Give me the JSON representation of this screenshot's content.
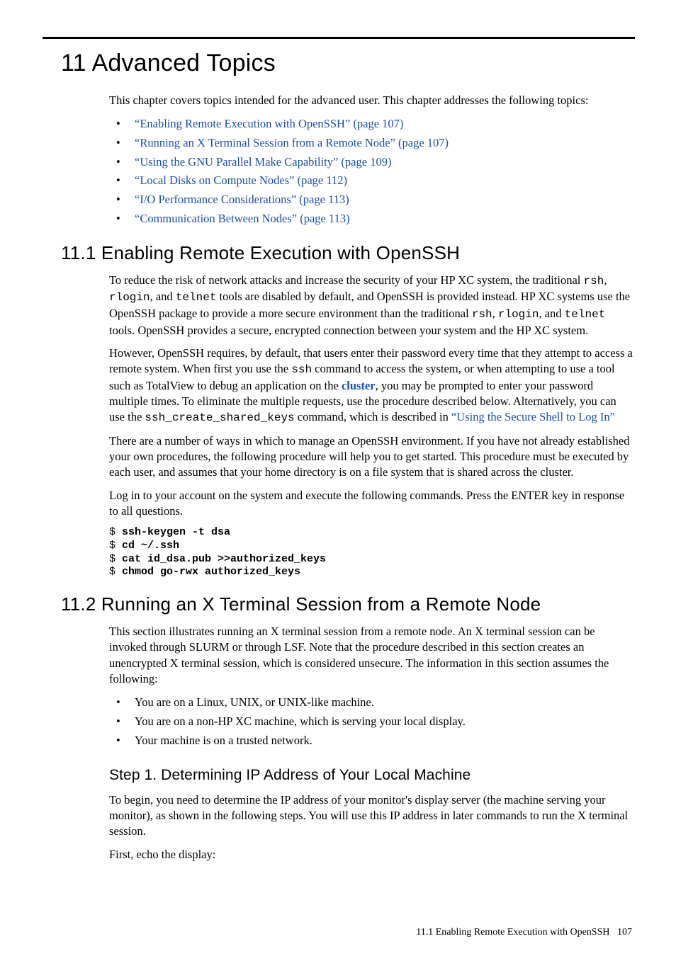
{
  "chapter": {
    "title": "11 Advanced Topics"
  },
  "intro": "This chapter covers topics intended for the advanced user. This chapter addresses the following topics:",
  "toc": [
    "“Enabling Remote Execution with OpenSSH” (page 107)",
    "“Running an X Terminal Session from a Remote Node” (page 107)",
    "“Using the GNU Parallel Make Capability” (page 109)",
    "“Local Disks on Compute Nodes” (page 112)",
    "“I/O Performance Considerations” (page 113)",
    "“Communication Between Nodes” (page 113)"
  ],
  "s11_1": {
    "heading": "11.1 Enabling Remote Execution with OpenSSH",
    "p1a": "To reduce the risk of network attacks and increase the security of your HP XC system, the traditional ",
    "p1b": "rsh",
    "p1c": ", ",
    "p1d": "rlogin",
    "p1e": ", and ",
    "p1f": "telnet",
    "p1g": " tools are disabled by default, and OpenSSH is provided instead. HP XC systems use the OpenSSH package to provide a more secure environment than the traditional ",
    "p1h": "rsh",
    "p1i": ", ",
    "p1j": "rlogin",
    "p1k": ", and ",
    "p1l": "telnet",
    "p1m": " tools. OpenSSH provides a secure, encrypted connection between your system and the HP XC system.",
    "p2a": "However, OpenSSH requires, by default, that users enter their password every time that they attempt to access a remote system. When first you use the ",
    "p2b": "ssh",
    "p2c": " command to access the system, or when attempting to use a tool such as TotalView to debug an application on the ",
    "p2_cluster": "cluster",
    "p2d": ", you may be prompted to enter your password multiple times. To eliminate the multiple requests, use the procedure described below. Alternatively, you can use the ",
    "p2e": "ssh_create_shared_keys",
    "p2f": " command, which is described in ",
    "p2_link": "“Using the Secure Shell to Log In”",
    "p3": "There are a number of ways in which to manage an OpenSSH environment. If you have not already established your own procedures, the following procedure will help you to get started. This procedure must be executed by each user, and assumes that your home directory is on a file system that is shared across the cluster.",
    "p4": "Log in to your account on the system and execute the following commands. Press the ENTER key in response to all questions.",
    "code": {
      "l1p": "$ ",
      "l1b": "ssh-keygen -t dsa",
      "l2p": "$ ",
      "l2b": "cd ~/.ssh",
      "l3p": "$ ",
      "l3b": "cat id_dsa.pub >>authorized_keys",
      "l4p": "$ ",
      "l4b": "chmod go-rwx authorized_keys"
    }
  },
  "s11_2": {
    "heading": "11.2 Running an X Terminal Session from a Remote Node",
    "p1": "This section illustrates running an X terminal session from a remote node. An X terminal session can be invoked through SLURM or through LSF. Note that the procedure described in this section creates an unencrypted X terminal session, which is considered unsecure. The information in this section assumes the following:",
    "bullets": [
      "You are on a Linux, UNIX, or UNIX-like machine.",
      "You are on a non-HP XC machine, which is serving your local display.",
      "Your machine is on a trusted network."
    ],
    "step1": {
      "heading": "Step 1. Determining IP Address of Your Local Machine",
      "p1": "To begin, you need to determine the IP address of your monitor's display server (the machine serving your monitor), as shown in the following steps. You will use this IP address in later commands to run the X terminal session.",
      "p2": "First, echo the display:"
    }
  },
  "footer": {
    "left": "11.1 Enabling Remote Execution with OpenSSH",
    "page": "107"
  }
}
